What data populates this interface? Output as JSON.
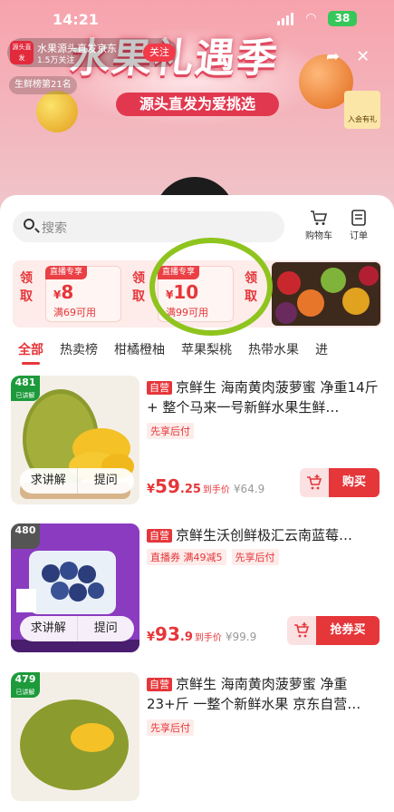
{
  "status": {
    "time": "14:21",
    "battery": "38"
  },
  "live": {
    "host_avatar_text": "源头直发",
    "host_name": "水果源头直发京东",
    "host_fans": "1.5万关注",
    "follow_label": "关注",
    "rank_text": "生鲜榜第21名",
    "banner_title": "水果礼遇季",
    "banner_subtitle": "源头直发为爱挑选",
    "shop_label": "入会有礼"
  },
  "search": {
    "placeholder": "搜索"
  },
  "toolbar": {
    "cart_label": "购物车",
    "orders_label": "订单"
  },
  "coupons": {
    "get_label": "领取",
    "items": [
      {
        "tag": "直播专享",
        "amount": "8",
        "currency": "¥",
        "condition": "满69可用"
      },
      {
        "tag": "直播专享",
        "amount": "10",
        "currency": "¥",
        "condition": "满99可用"
      }
    ]
  },
  "categories": [
    "全部",
    "热卖榜",
    "柑橘橙柚",
    "苹果梨桃",
    "热带水果",
    "进"
  ],
  "products": [
    {
      "rank": "481",
      "rank_sub": "已讲解",
      "self_tag": "自营",
      "title": "京鲜生 海南黄肉菠萝蜜 净重14斤+ 整个马来一号新鲜水果生鲜…",
      "tags": [
        "先享后付"
      ],
      "price_int": "59",
      "price_dec": ".25",
      "price_label": "到手价",
      "orig_price": "¥64.9",
      "buy_label": "购买",
      "explain_label": "求讲解",
      "ask_label": "提问"
    },
    {
      "rank": "480",
      "rank_sub": "",
      "self_tag": "自营",
      "title": "京鲜生沃创鲜极汇云南蓝莓…",
      "tags": [
        "直播券 满49减5",
        "先享后付"
      ],
      "price_int": "93",
      "price_dec": ".9",
      "price_label": "到手价",
      "orig_price": "¥99.9",
      "buy_label": "抢券买",
      "explain_label": "求讲解",
      "ask_label": "提问"
    },
    {
      "rank": "479",
      "rank_sub": "已讲解",
      "self_tag": "自营",
      "title": "京鲜生 海南黄肉菠萝蜜 净重23+斤 一整个新鲜水果 京东自营…",
      "tags": [
        "先享后付"
      ],
      "price_int": "",
      "price_dec": "",
      "price_label": "",
      "orig_price": "",
      "buy_label": "",
      "explain_label": "",
      "ask_label": ""
    }
  ],
  "colors": {
    "accent": "#e5363a",
    "highlight": "#8fc41f",
    "rank_green": "#1d9a3b"
  }
}
